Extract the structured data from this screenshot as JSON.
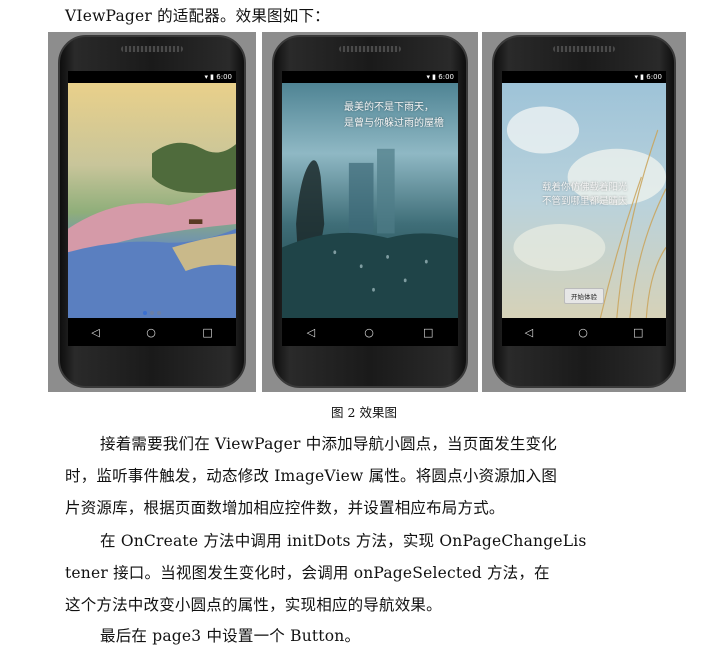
{
  "intro_line": "VIewPager 的适配器。效果图如下：",
  "screenshots": [
    {
      "time": "6:00",
      "nav": {
        "back": "◁",
        "home": "○",
        "recent": "□"
      }
    },
    {
      "time": "6:00",
      "quote_line1": "最美的不是下雨天，",
      "quote_line2": "是曾与你躲过雨的屋檐",
      "nav": {
        "back": "◁",
        "home": "○",
        "recent": "□"
      }
    },
    {
      "time": "6:00",
      "quote_line1": "载着你仿佛载着阳光",
      "quote_line2": "不管到哪里都是晴天",
      "button_label": "开始体验",
      "nav": {
        "back": "◁",
        "home": "○",
        "recent": "□"
      }
    }
  ],
  "caption": "图 2 效果图",
  "paragraph_lines": [
    "接着需要我们在 ViewPager 中添加导航小圆点，当页面发生变化",
    "时，监听事件触发，动态修改 ImageView 属性。将圆点小资源加入图",
    "片资源库，根据页面数增加相应控件数，并设置相应布局方式。",
    "在 OnCreate 方法中调用 initDots 方法，实现 OnPageChangeLis",
    "tener 接口。当视图发生变化时，会调用 onPageSelected 方法，在",
    "这个方法中改变小圆点的属性，实现相应的导航效果。",
    "最后在 page3 中设置一个 Button。"
  ]
}
